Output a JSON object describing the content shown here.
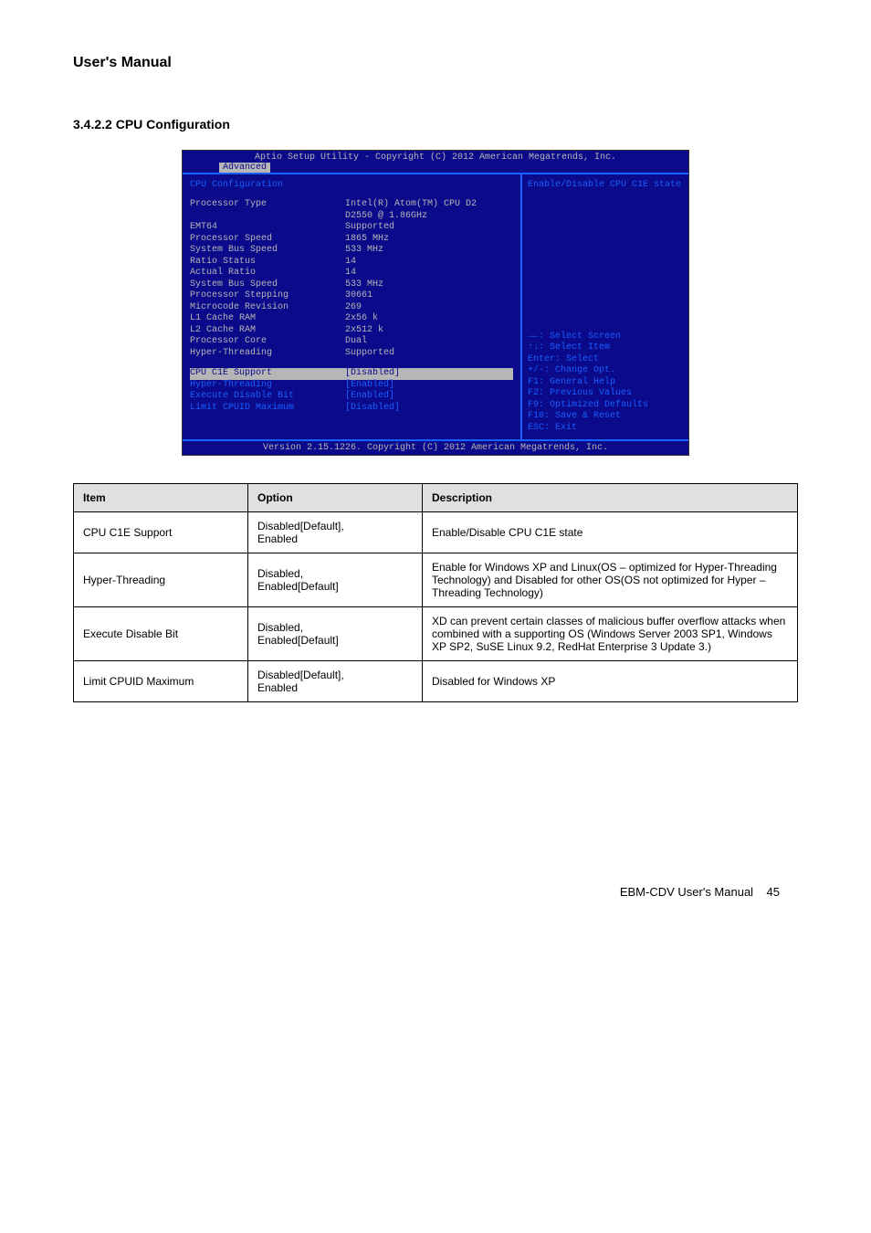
{
  "header": "User's Manual",
  "section_title": "3.4.2.2 CPU Configuration",
  "bios": {
    "top": "Aptio Setup Utility - Copyright (C) 2012 American Megatrends, Inc.",
    "tab": "Advanced",
    "heading": "CPU Configuration",
    "info_rows": [
      {
        "label": "Processor Type",
        "value": "Intel(R) Atom(TM) CPU D2"
      },
      {
        "label": "",
        "value": "D2550   @ 1.86GHz"
      },
      {
        "label": "EMT64",
        "value": "Supported"
      },
      {
        "label": "Processor Speed",
        "value": "1865 MHz"
      },
      {
        "label": "System Bus Speed",
        "value": "533 MHz"
      },
      {
        "label": "Ratio Status",
        "value": "14"
      },
      {
        "label": "Actual Ratio",
        "value": "14"
      },
      {
        "label": "System Bus Speed",
        "value": "533 MHz"
      },
      {
        "label": "Processor Stepping",
        "value": "30661"
      },
      {
        "label": "Microcode Revision",
        "value": "269"
      },
      {
        "label": "L1 Cache RAM",
        "value": "2x56 k"
      },
      {
        "label": "L2 Cache RAM",
        "value": "2x512 k"
      },
      {
        "label": "Processor Core",
        "value": "Dual"
      },
      {
        "label": "Hyper-Threading",
        "value": "Supported"
      }
    ],
    "config_rows": [
      {
        "label": "CPU C1E Support",
        "value": "[Disabled]",
        "selected": true
      },
      {
        "label": "Hyper-Threading",
        "value": "[Enabled]",
        "selected": false
      },
      {
        "label": "Execute Disable Bit",
        "value": "[Enabled]",
        "selected": false
      },
      {
        "label": "Limit CPUID Maximum",
        "value": "[Disabled]",
        "selected": false
      }
    ],
    "right_top": "Enable/Disable CPU C1E state",
    "help_lines": [
      "→←: Select Screen",
      "↑↓: Select Item",
      "Enter: Select",
      "+/-: Change Opt.",
      "F1: General Help",
      "F2: Previous Values",
      "F9: Optimized Defaults",
      "F10: Save & Reset",
      "ESC: Exit"
    ],
    "footer": "Version 2.15.1226. Copyright (C) 2012 American Megatrends, Inc."
  },
  "table": {
    "headers": [
      "Item",
      "Option",
      "Description"
    ],
    "rows": [
      {
        "item": "CPU C1E Support",
        "option": "Disabled[Default],\nEnabled",
        "desc": "Enable/Disable CPU C1E state"
      },
      {
        "item": "Hyper-Threading",
        "option": "Disabled,\nEnabled[Default]",
        "desc": "Enable for Windows XP and Linux(OS – optimized for Hyper-Threading Technology) and Disabled for other OS(OS not optimized for Hyper – Threading Technology)"
      },
      {
        "item": "Execute Disable Bit",
        "option": "Disabled,\nEnabled[Default]",
        "desc": "XD can prevent certain classes of malicious buffer overflow attacks when combined with a supporting OS (Windows Server 2003 SP1, Windows XP SP2, SuSE Linux 9.2, RedHat Enterprise 3 Update 3.)"
      },
      {
        "item": "Limit CPUID Maximum",
        "option": "Disabled[Default],\nEnabled",
        "desc": "Disabled for Windows XP"
      }
    ]
  },
  "page_footer_label": "EBM-CDV User's Manual",
  "page_number": "45"
}
